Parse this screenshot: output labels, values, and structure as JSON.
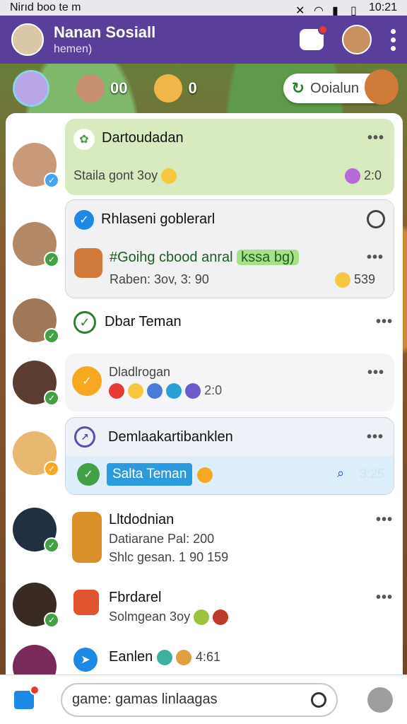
{
  "status_bar": {
    "carrier": "Nirıd boo te m",
    "time": "10:21"
  },
  "app_bar": {
    "title": "Nanan Sosiall",
    "subtitle": "hemen)"
  },
  "hud": {
    "score_a": "00",
    "score_b": "0",
    "pill_label": "Ooialun"
  },
  "rows": [
    {
      "name": "Dartoudadan",
      "sub": "Staila gont 3oy",
      "meta": "2:0",
      "more": "•••"
    },
    {
      "name": "Rhlaseni goblerarl",
      "line2": "#Goihg cbood anral",
      "highlight": "kssa bg)",
      "sub": "Raben: 3ov,  3: 90",
      "meta": "539",
      "more": "•••"
    },
    {
      "name": "Dbar Teman",
      "more": "•••"
    },
    {
      "name": "Dladlrogan",
      "meta": "2:0",
      "more": "•••"
    },
    {
      "name": "Demlaakartibanklen",
      "button": "Salta Teman",
      "meta": "3:25",
      "more": "•••"
    },
    {
      "name": "Lltdodnian",
      "line2": "Datiarane  Pal: 200",
      "sub": "Shlc gesan. 1 90 159",
      "more": "•••"
    },
    {
      "name": "Fbrdarel",
      "sub": "Solmgean 3oy",
      "more": "•••"
    },
    {
      "name": "Eanlen",
      "meta": "4:61"
    }
  ],
  "search": {
    "value": "game: gamas linlaagas"
  },
  "colors": {
    "appbar": "#5a3f9a",
    "accent_green": "#43a047",
    "accent_blue": "#1e88e5"
  }
}
